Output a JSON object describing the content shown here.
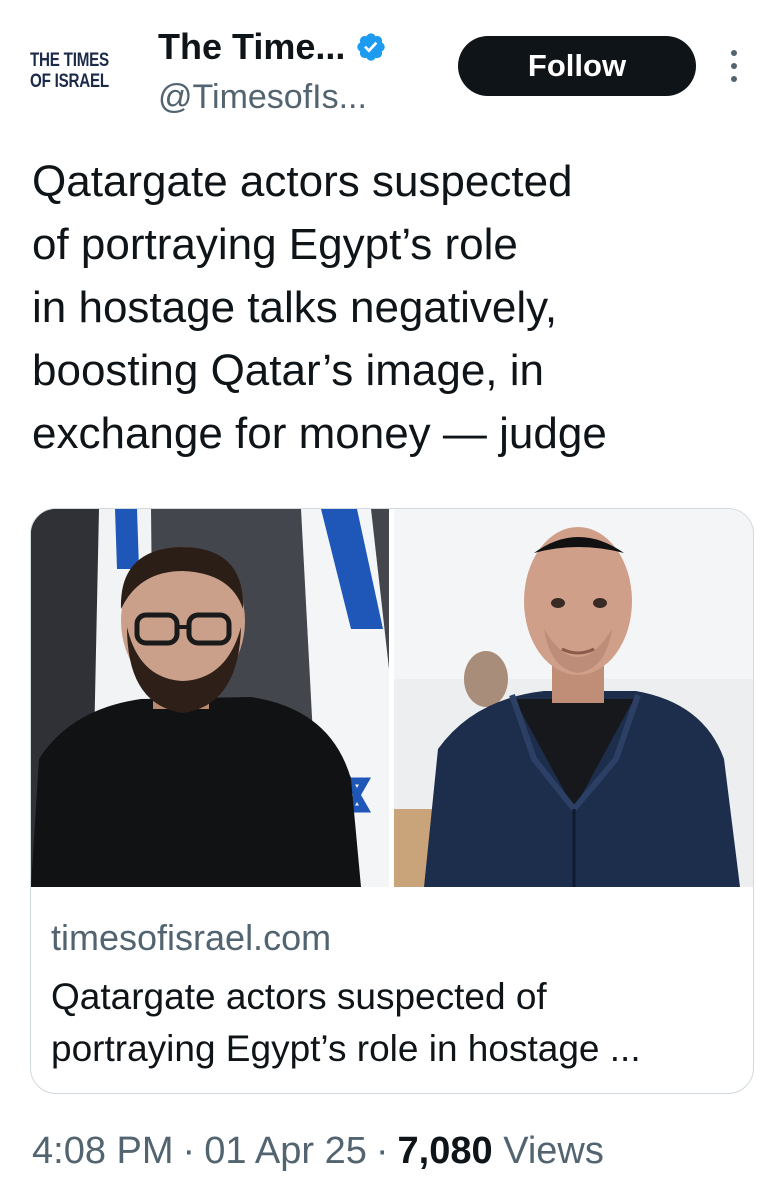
{
  "account": {
    "logo_line1": "THE TIMES",
    "logo_line2": "OF ISRAEL",
    "display_name": "The Time...",
    "handle": "@TimesofIs...",
    "verified_icon": "verified-badge-icon",
    "follow_label": "Follow",
    "more_icon": "more-options-icon"
  },
  "tweet": {
    "text_lines": [
      "Qatargate actors suspected",
      "of portraying Egypt’s role",
      "in hostage talks negatively,",
      "boosting Qatar’s image, in",
      "exchange for money — judge"
    ]
  },
  "card": {
    "domain": "timesofisrael.com",
    "title_lines": [
      "Qatargate actors suspected of",
      "portraying Egypt’s role in hostage ..."
    ]
  },
  "meta": {
    "time": "4:08 PM",
    "date": "01 Apr 25",
    "views_count": "7,080",
    "views_label": "Views"
  },
  "colors": {
    "text": "#0f1419",
    "secondary": "#536471",
    "verified": "#1d9bf0",
    "follow_bg": "#0f1419",
    "border": "#cfd9de"
  }
}
